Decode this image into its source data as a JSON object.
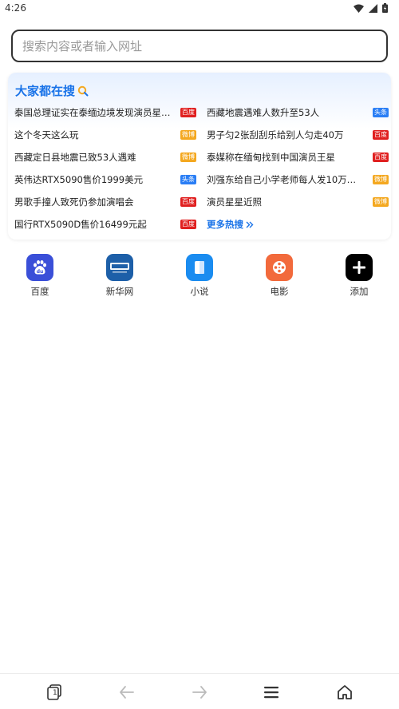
{
  "status_bar": {
    "time": "4:26"
  },
  "search": {
    "placeholder": "搜索内容或者输入网址"
  },
  "hot": {
    "title": "大家都在搜",
    "left": [
      {
        "text": "泰国总理证实在泰缅边境发现演员星…",
        "source": "百度",
        "color": "#e02020"
      },
      {
        "text": "这个冬天这么玩",
        "source": "微博",
        "color": "#f4a820"
      },
      {
        "text": "西藏定日县地震已致53人遇难",
        "source": "微博",
        "color": "#f4a820"
      },
      {
        "text": "英伟达RTX5090售价1999美元",
        "source": "头条",
        "color": "#2a7ef5"
      },
      {
        "text": "男歌手撞人致死仍参加演唱会",
        "source": "百度",
        "color": "#e02020"
      },
      {
        "text": "国行RTX5090D售价16499元起",
        "source": "百度",
        "color": "#e02020"
      }
    ],
    "right": [
      {
        "text": "西藏地震遇难人数升至53人",
        "source": "头条",
        "color": "#2a7ef5"
      },
      {
        "text": "男子匀2张刮刮乐给别人匀走40万",
        "source": "百度",
        "color": "#e02020"
      },
      {
        "text": "泰媒称在缅甸找到中国演员王星",
        "source": "百度",
        "color": "#e02020"
      },
      {
        "text": "刘强东给自己小学老师每人发10万现…",
        "source": "微博",
        "color": "#f4a820"
      },
      {
        "text": "演员星星近照",
        "source": "微博",
        "color": "#f4a820"
      }
    ],
    "more": "更多热搜"
  },
  "shortcuts": [
    {
      "label": "百度",
      "icon": "baidu-icon",
      "color": "#3a4fd8"
    },
    {
      "label": "新华网",
      "icon": "xinhua-icon",
      "color": "#1d5fa8"
    },
    {
      "label": "小说",
      "icon": "novel-book-icon",
      "color": "#1a8cf0"
    },
    {
      "label": "电影",
      "icon": "film-reel-icon",
      "color": "#f26a3c"
    },
    {
      "label": "添加",
      "icon": "add-icon",
      "color": "#000000"
    }
  ],
  "bottom_nav": {
    "tab_count": "1"
  }
}
